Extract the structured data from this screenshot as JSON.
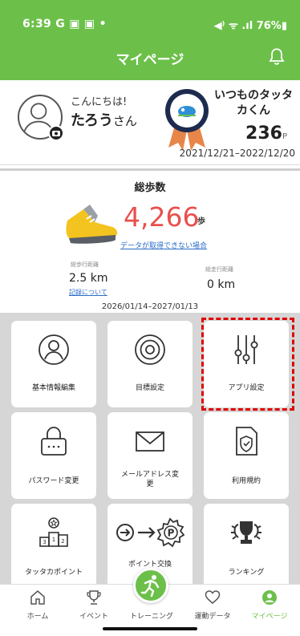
{
  "status_bar": {
    "time": "6:39",
    "app_icons": "G",
    "right": "76%"
  },
  "header": {
    "title": "マイページ"
  },
  "profile": {
    "greeting": "こんにちは!",
    "name": "たろう",
    "name_suffix": "さん",
    "points_name": "いつものタッタカくん",
    "points_value": "236",
    "points_unit": "P",
    "points_period": "2021/12/21–2022/12/20"
  },
  "steps": {
    "title": "総歩数",
    "value": "4,266",
    "unit": "歩",
    "no_data_link": "データが取得できない場合",
    "walk_label": "総歩行距離",
    "walk_value": "2.5 km",
    "walk_link": "記録について",
    "run_label": "総走行距離",
    "run_value": "0 km",
    "period": "2026/01/14–2027/01/13"
  },
  "menu": {
    "basic_info": "基本情報編集",
    "goal": "目標設定",
    "app_settings": "アプリ設定",
    "password": "パスワード変更",
    "email": "メールアドレス変\n更",
    "terms": "利用規約",
    "tattaka_points": "タッタカポイント",
    "points_exchange": "ポイント交換",
    "ranking": "ランキング"
  },
  "nav": {
    "home": "ホーム",
    "event": "イベント",
    "training": "トレーニング",
    "activity": "運動データ",
    "mypage": "マイページ"
  },
  "colors": {
    "brand": "#6cc04a",
    "steps": "#e8504d",
    "link": "#2a6cc8",
    "highlight": "#e00000"
  }
}
